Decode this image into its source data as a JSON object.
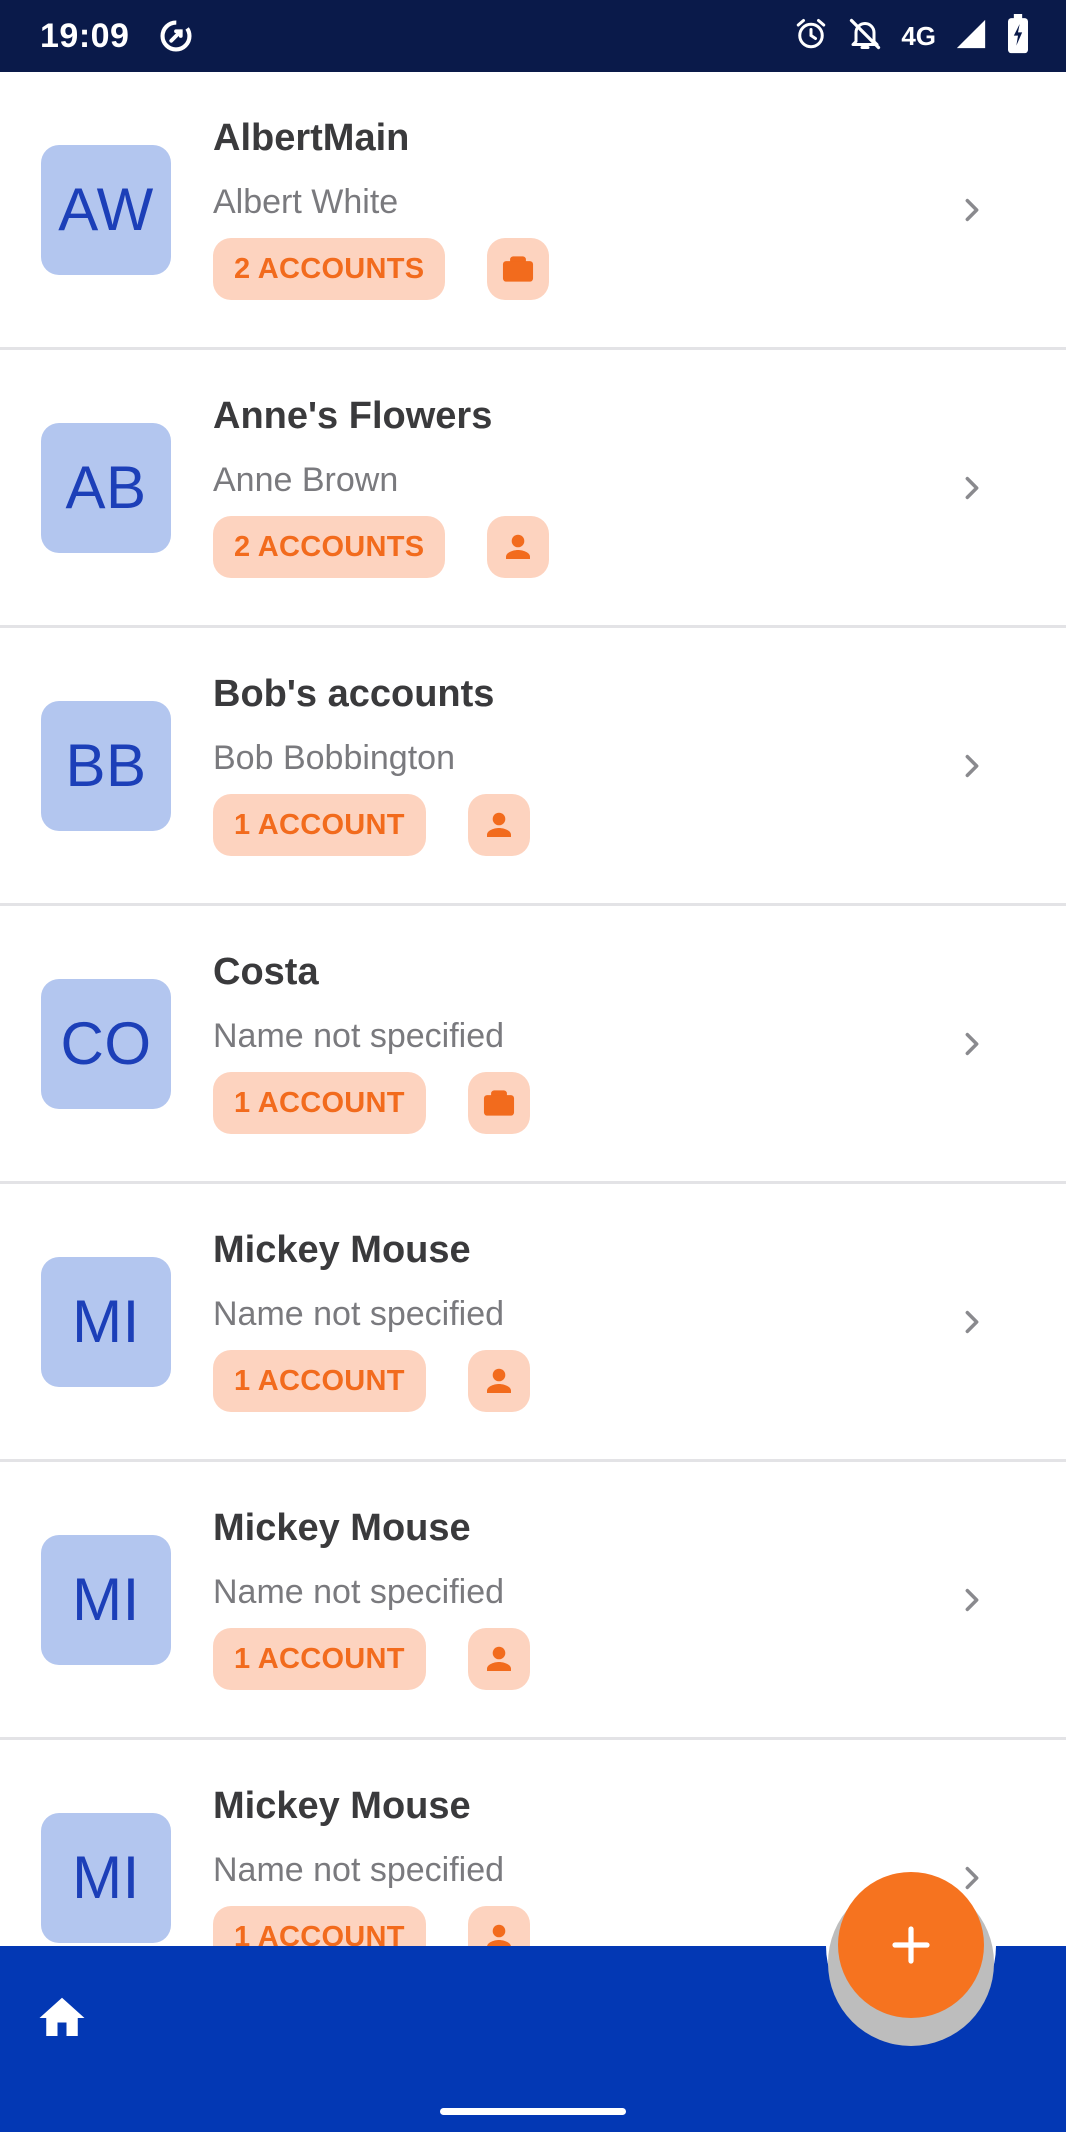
{
  "status_bar": {
    "time": "19:09",
    "network": "4G",
    "icons": [
      "data-saver-icon",
      "alarm-icon",
      "bell-off-icon",
      "signal-icon",
      "battery-charging-icon"
    ]
  },
  "list": {
    "items": [
      {
        "initials": "AW",
        "title": "AlbertMain",
        "subtitle": "Albert White",
        "badge": "2 ACCOUNTS",
        "type_icon": "briefcase-icon"
      },
      {
        "initials": "AB",
        "title": "Anne's Flowers",
        "subtitle": "Anne Brown",
        "badge": "2 ACCOUNTS",
        "type_icon": "person-icon"
      },
      {
        "initials": "BB",
        "title": "Bob's accounts",
        "subtitle": "Bob Bobbington",
        "badge": "1 ACCOUNT",
        "type_icon": "person-icon"
      },
      {
        "initials": "CO",
        "title": "Costa",
        "subtitle": "Name not specified",
        "badge": "1 ACCOUNT",
        "type_icon": "briefcase-icon"
      },
      {
        "initials": "MI",
        "title": "Mickey Mouse",
        "subtitle": "Name not specified",
        "badge": "1 ACCOUNT",
        "type_icon": "person-icon"
      },
      {
        "initials": "MI",
        "title": "Mickey Mouse",
        "subtitle": "Name not specified",
        "badge": "1 ACCOUNT",
        "type_icon": "person-icon"
      },
      {
        "initials": "MI",
        "title": "Mickey Mouse",
        "subtitle": "Name not specified",
        "badge": "1 ACCOUNT",
        "type_icon": "person-icon"
      }
    ]
  },
  "bottom_bar": {
    "home_icon": "home-icon",
    "fab_icon": "plus-icon"
  },
  "colors": {
    "status_bar": "#0a1a4a",
    "avatar_bg": "#b3c6ef",
    "avatar_text": "#1c3fb8",
    "badge_bg": "#fdd3bf",
    "badge_text": "#f26b1d",
    "bottom_bar": "#0338b4",
    "fab": "#f6731f"
  }
}
